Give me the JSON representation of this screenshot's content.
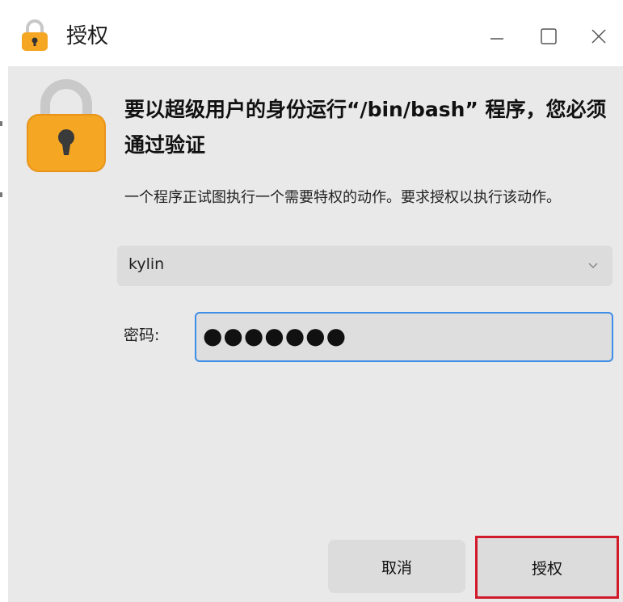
{
  "window": {
    "title": "授权",
    "controls": {
      "minimize": "minimize-icon",
      "maximize": "maximize-icon",
      "close": "close-icon"
    }
  },
  "dialog": {
    "heading": "要以超级用户的身份运行“/bin/bash” 程序，您必须通过验证",
    "description": "一个程序正试图执行一个需要特权的动作。要求授权以执行该动作。",
    "user_select": {
      "value": "kylin"
    },
    "password": {
      "label": "密码:",
      "value": "●●●●●●●"
    }
  },
  "buttons": {
    "cancel": "取消",
    "authorize": "授权"
  },
  "colors": {
    "lock_body": "#f5a623",
    "focus_border": "#3d8ee6",
    "highlight_border": "#d11a2a",
    "window_bg": "#e9e9e9"
  },
  "icons": {
    "title_icon": "lock-icon",
    "dialog_icon": "lock-icon",
    "dropdown": "chevron-down-icon"
  }
}
